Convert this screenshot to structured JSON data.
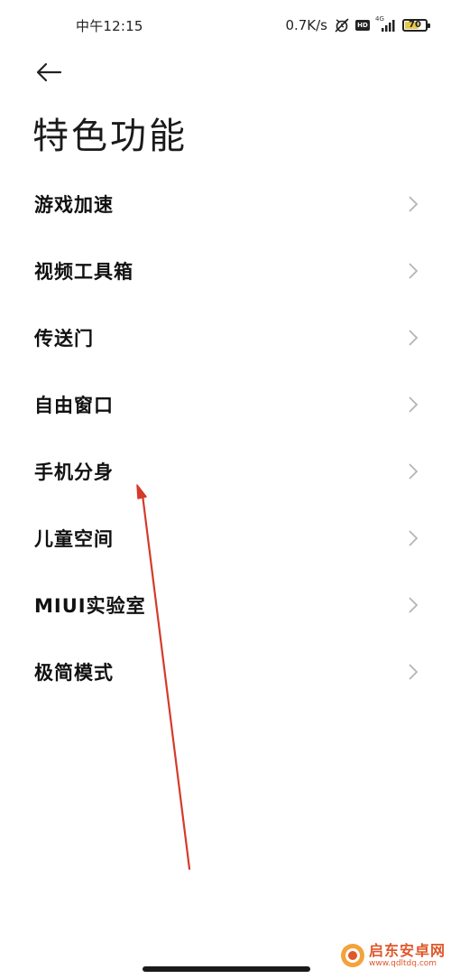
{
  "status_bar": {
    "time": "中午12:15",
    "net_speed": "0.7K/s",
    "hd_label": "HD",
    "network_type": "4G",
    "battery_level": "70",
    "battery_percent": 70,
    "battery_color": "#e6c84a"
  },
  "header": {
    "back_icon": "arrow-left-icon",
    "title": "特色功能"
  },
  "menu": {
    "items": [
      {
        "label": "游戏加速"
      },
      {
        "label": "视频工具箱"
      },
      {
        "label": "传送门"
      },
      {
        "label": "自由窗口"
      },
      {
        "label": "手机分身"
      },
      {
        "label": "儿童空间"
      },
      {
        "label": "MIUI实验室"
      },
      {
        "label": "极简模式"
      }
    ],
    "chevron_icon": "chevron-right-icon"
  },
  "annotation": {
    "arrow_color": "#d63a2a",
    "points_to": "手机分身"
  },
  "watermark": {
    "title": "启东安卓网",
    "url": "www.qdltdq.com",
    "color": "#e0572a"
  }
}
